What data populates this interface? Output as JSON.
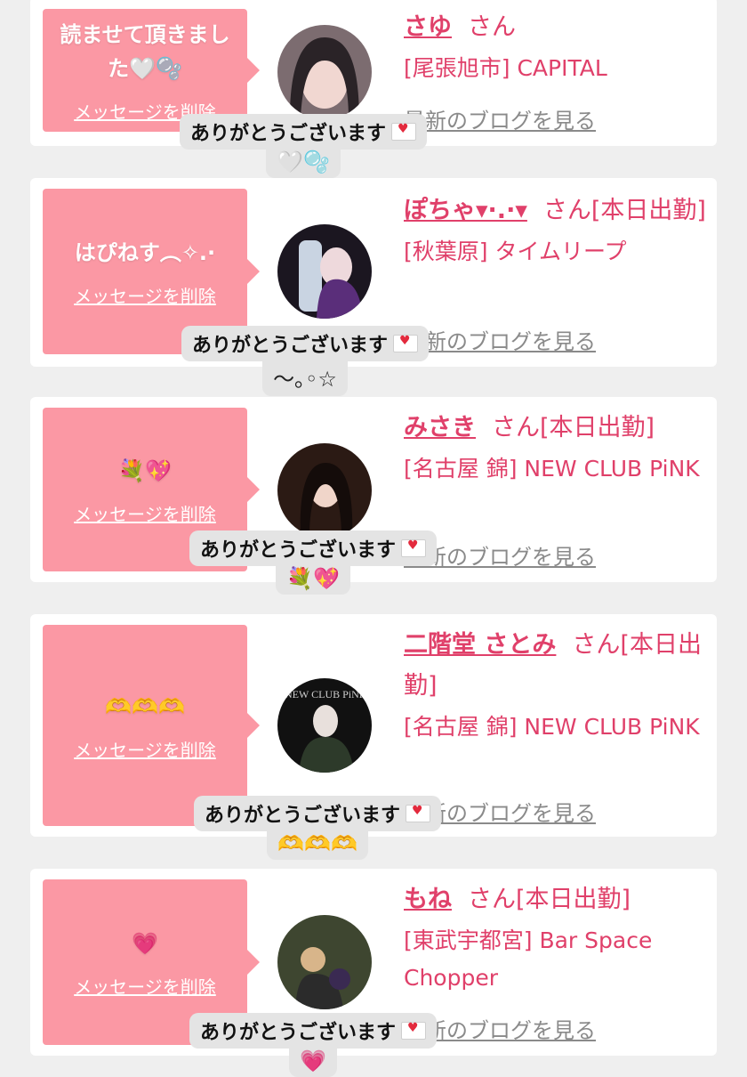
{
  "delete_label": "メッセージを削除",
  "thanks_label": "ありがとうございます",
  "san_label": "さん",
  "blog_label": "最新のブログを見る",
  "items": [
    {
      "message": "読ませて頂きました🤍🫧",
      "name": "さゆ",
      "shift": "",
      "shop": "[尾張旭市] CAPITAL",
      "reaction": "🤍🫧"
    },
    {
      "message": "はぴねす︵✧.·",
      "name": "ぽちゃ▾·.·▾",
      "shift": "[本日出勤]",
      "shop": "[秋葉原] タイムリープ",
      "reaction": "〜｡◦☆"
    },
    {
      "message": "💐💖",
      "name": "みさき",
      "shift": "[本日出勤]",
      "shop": "[名古屋 錦] NEW CLUB PiNK",
      "reaction": "💐💖"
    },
    {
      "message": "🫶🫶🫶",
      "name": "二階堂 さとみ",
      "shift": "[本日出勤]",
      "shop": "[名古屋 錦] NEW CLUB PiNK",
      "reaction": "🫶🫶🫶"
    },
    {
      "message": "💗",
      "name": "もね",
      "shift": "[本日出勤]",
      "shop": "[東武宇都宮] Bar Space Chopper",
      "reaction": "💗"
    }
  ]
}
